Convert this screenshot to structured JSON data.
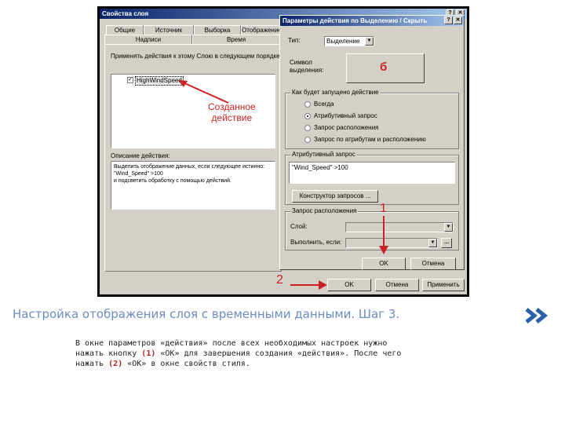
{
  "outer_dialog": {
    "title": "Свойства слоя",
    "tabs": [
      "Общие",
      "Источник",
      "Выборка",
      "Отображение",
      "Надписи",
      "Время"
    ],
    "apply_label": "Применять действия к этому Слою в следующем порядке:",
    "actions": [
      {
        "label": "HighWindSpeed",
        "checked": true
      }
    ],
    "description_label": "Описание действия:",
    "description_text": "Выделить отображение данных, если следующее истинно:\n\"Wind_Speed\" >100\nи подсветить обработку с помощью действий.",
    "ok_label": "OK",
    "cancel_label": "Отмена",
    "apply_button_label": "Применить"
  },
  "inner_dialog": {
    "title": "Параметры действия по Выделению / Скрыть",
    "type_label": "Тип:",
    "type_value": "Выделение",
    "symbol_label": "Символ выделения:",
    "symbol_preview": "б",
    "when_group_title": "Как будет запущено действие",
    "radios": [
      {
        "label": "Всегда",
        "selected": false
      },
      {
        "label": "Атрибутивный запрос",
        "selected": true
      },
      {
        "label": "Запрос расположения",
        "selected": false
      },
      {
        "label": "Запрос по атрибутам и расположению",
        "selected": false
      }
    ],
    "attr_group_title": "Атрибутивный запрос",
    "attr_query": "\"Wind_Speed\" >100",
    "query_builder_button": "Конструктор запросов ...",
    "loc_group_title": "Запрос расположения",
    "layer_label": "Слой:",
    "execute_label": "Выполнить, если:",
    "ok_label": "OK",
    "cancel_label": "Отмена"
  },
  "annotations": {
    "created_action": "Созданное\nдействие",
    "step1": "1",
    "step2": "2",
    "color": "#cc2222"
  },
  "caption": "Настройка отображения слоя с временными данными. Шаг 3.",
  "description": {
    "line1": "В окне параметров «действия» после всех необходимых настроек нужно",
    "line2_a": "нажать кнопку ",
    "line2_num": "(1)",
    "line2_b": " «ОК» для завершения создания «действия». После чего",
    "line3_a": "нажать ",
    "line3_num": "(2)",
    "line3_b": " «ОК» в окне свойств стиля."
  },
  "colors": {
    "caption": "#6b8cc0",
    "titlebar": "#0a246a",
    "dialog_bg": "#d4d0c8"
  }
}
